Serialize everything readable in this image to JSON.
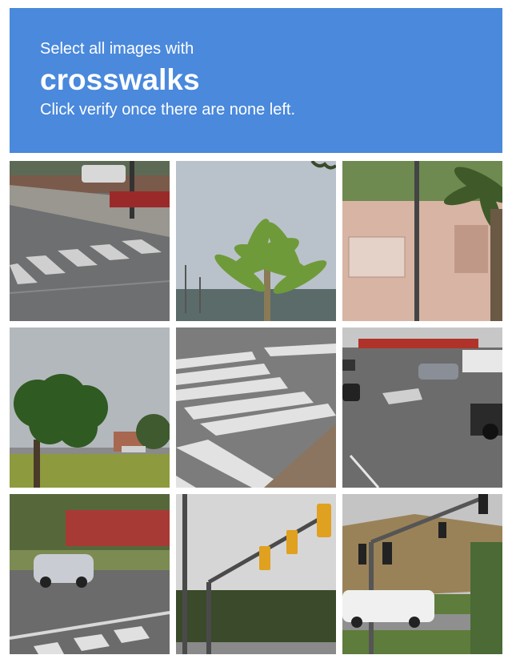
{
  "challenge": {
    "instruction_prefix": "Select all images with",
    "target_object": "crosswalks",
    "instruction_suffix": "Click verify once there are none left.",
    "header_color": "#4a89dc"
  },
  "grid": {
    "rows": 3,
    "cols": 3,
    "tiles": [
      {
        "index": 1,
        "content": "crosswalk-street"
      },
      {
        "index": 2,
        "content": "palm-tree-sky"
      },
      {
        "index": 3,
        "content": "building-wall-palm"
      },
      {
        "index": 4,
        "content": "tree-cloudy-sky"
      },
      {
        "index": 5,
        "content": "crosswalk-closeup"
      },
      {
        "index": 6,
        "content": "road-traffic"
      },
      {
        "index": 7,
        "content": "street-parked-car-crosswalk"
      },
      {
        "index": 8,
        "content": "traffic-lights-pole"
      },
      {
        "index": 9,
        "content": "traffic-lights-hill-van"
      }
    ]
  }
}
